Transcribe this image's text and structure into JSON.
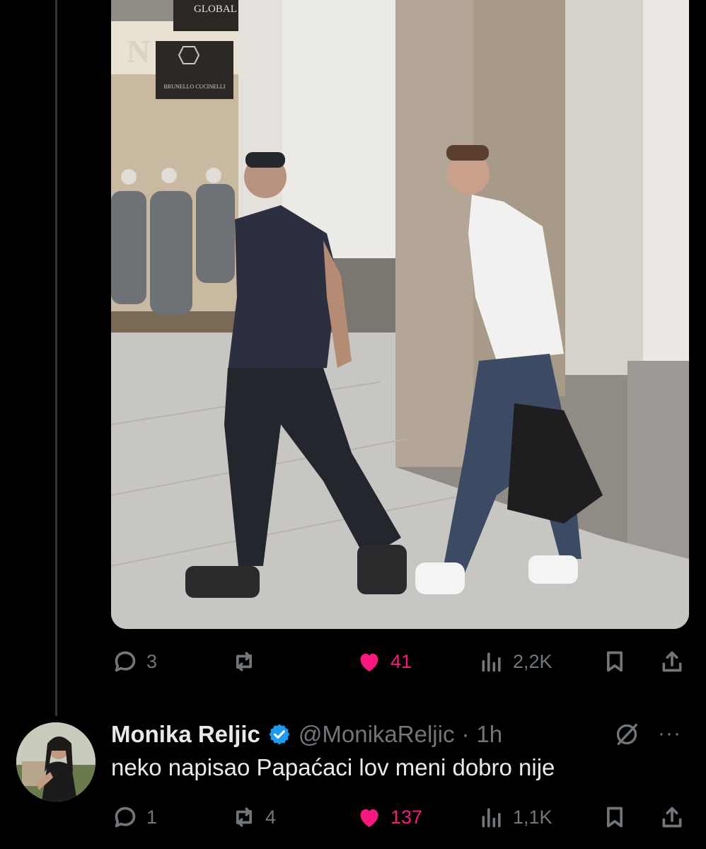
{
  "post": {
    "photo": {
      "store_sign": "GLOBAL FASHION",
      "logo": "BRUNELLO CUCINELLI",
      "partial_sign": "N"
    },
    "actions": {
      "replies": "3",
      "reposts": "",
      "likes": "41",
      "views": "2,2K"
    }
  },
  "reply": {
    "author_name": "Monika Reljic",
    "handle": "@MonikaReljic",
    "separator": "·",
    "time": "1h",
    "more": "···",
    "text": "neko napisao Papaćaci lov meni dobro nije",
    "actions": {
      "replies": "1",
      "reposts": "4",
      "likes": "137",
      "views": "1,1K"
    }
  },
  "colors": {
    "background": "#000000",
    "muted": "#71767b",
    "like": "#f91880",
    "verified": "#1d9bf0"
  },
  "icons": [
    "reply-icon",
    "repost-icon",
    "like-icon",
    "views-icon",
    "bookmark-icon",
    "share-icon",
    "verified-badge-icon",
    "grok-icon",
    "more-icon"
  ]
}
